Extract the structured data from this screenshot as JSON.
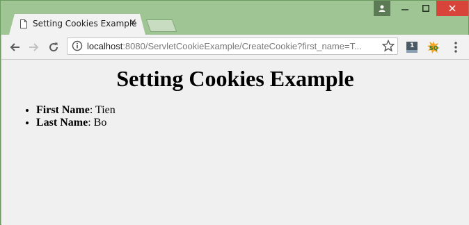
{
  "tab": {
    "title": "Setting Cookies Example"
  },
  "address_bar": {
    "host": "localhost",
    "rest": ":8080/ServletCookieExample/CreateCookie?first_name=T..."
  },
  "page": {
    "heading": "Setting Cookies Example",
    "items": [
      {
        "label": "First Name",
        "value": ": Tien"
      },
      {
        "label": "Last Name",
        "value": ": Bo"
      }
    ]
  },
  "extensions": {
    "badge_count": "1"
  },
  "colors": {
    "frame": "#9fc594",
    "close": "#d9443a"
  }
}
